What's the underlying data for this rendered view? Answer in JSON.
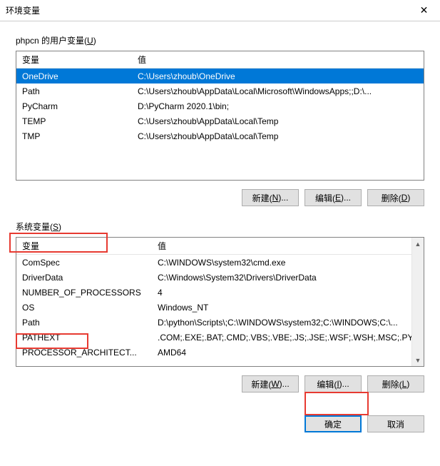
{
  "window": {
    "title": "环境变量"
  },
  "user_section": {
    "label_prefix": "phpcn 的用户变量(",
    "label_key": "U",
    "label_suffix": ")",
    "headers": {
      "variable": "变量",
      "value": "值"
    },
    "rows": [
      {
        "name": "OneDrive",
        "value": "C:\\Users\\zhoub\\OneDrive",
        "selected": true
      },
      {
        "name": "Path",
        "value": "C:\\Users\\zhoub\\AppData\\Local\\Microsoft\\WindowsApps;;D:\\...",
        "selected": false
      },
      {
        "name": "PyCharm",
        "value": "D:\\PyCharm 2020.1\\bin;",
        "selected": false
      },
      {
        "name": "TEMP",
        "value": "C:\\Users\\zhoub\\AppData\\Local\\Temp",
        "selected": false
      },
      {
        "name": "TMP",
        "value": "C:\\Users\\zhoub\\AppData\\Local\\Temp",
        "selected": false
      }
    ],
    "buttons": {
      "new_p": "新建(",
      "new_k": "N",
      "new_s": ")...",
      "edit_p": "编辑(",
      "edit_k": "E",
      "edit_s": ")...",
      "del_p": "删除(",
      "del_k": "D",
      "del_s": ")"
    }
  },
  "system_section": {
    "label_prefix": "系统变量(",
    "label_key": "S",
    "label_suffix": ")",
    "headers": {
      "variable": "变量",
      "value": "值"
    },
    "rows": [
      {
        "name": "ComSpec",
        "value": "C:\\WINDOWS\\system32\\cmd.exe"
      },
      {
        "name": "DriverData",
        "value": "C:\\Windows\\System32\\Drivers\\DriverData"
      },
      {
        "name": "NUMBER_OF_PROCESSORS",
        "value": "4"
      },
      {
        "name": "OS",
        "value": "Windows_NT"
      },
      {
        "name": "Path",
        "value": "D:\\python\\Scripts\\;C:\\WINDOWS\\system32;C:\\WINDOWS;C:\\..."
      },
      {
        "name": "PATHEXT",
        "value": ".COM;.EXE;.BAT;.CMD;.VBS;.VBE;.JS;.JSE;.WSF;.WSH;.MSC;.PY;.P..."
      },
      {
        "name": "PROCESSOR_ARCHITECT...",
        "value": "AMD64"
      }
    ],
    "buttons": {
      "new_p": "新建(",
      "new_k": "W",
      "new_s": ")...",
      "edit_p": "编辑(",
      "edit_k": "I",
      "edit_s": ")...",
      "del_p": "删除(",
      "del_k": "L",
      "del_s": ")"
    }
  },
  "footer": {
    "ok": "确定",
    "cancel": "取消"
  }
}
